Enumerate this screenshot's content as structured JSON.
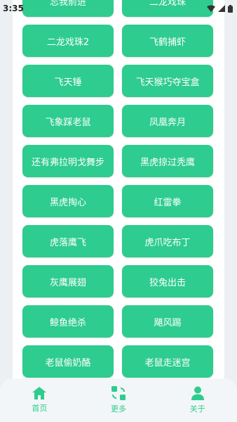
{
  "status_bar": {
    "time": "3:35"
  },
  "buttons": [
    "忘我前进",
    "二龙戏珠",
    "二龙戏珠2",
    "飞鹤捕虾",
    "飞天锤",
    "飞天猴巧夺宝盒",
    "飞象踩老鼠",
    "凤凰奔月",
    "还有弗拉明戈舞步",
    "黑虎掠过秃鹰",
    "黑虎掏心",
    "红雷拳",
    "虎落鹰飞",
    "虎爪吃布丁",
    "灰鹰展翅",
    "狡兔出击",
    "鲸鱼绝杀",
    "飓风踢",
    "老鼠偷奶酪",
    "老鼠走迷宫"
  ],
  "bottom_nav": [
    {
      "label": "首页",
      "icon": "home-icon"
    },
    {
      "label": "更多",
      "icon": "more-icon"
    },
    {
      "label": "关于",
      "icon": "user-icon"
    }
  ],
  "colors": {
    "accent": "#2ecc8e",
    "background": "#ecf0f3",
    "panel": "#ffffff"
  }
}
